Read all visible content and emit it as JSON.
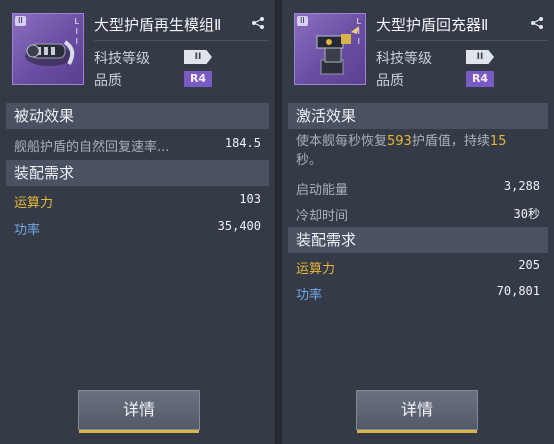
{
  "left": {
    "title": "大型护盾再生模组Ⅱ",
    "tier_badge": "II",
    "tech_label": "科技等级",
    "tech_badge": "II",
    "quality_label": "品质",
    "quality_badge": "R4",
    "passive_header": "被动效果",
    "passive_text": "舰船护盾的自然回复速率...",
    "passive_value": "184.5",
    "req_header": "装配需求",
    "cpu_label": "运算力",
    "cpu_value": "103",
    "power_label": "功率",
    "power_value": "35,400",
    "details_button": "详情"
  },
  "right": {
    "title": "大型护盾回充器Ⅱ",
    "tier_badge": "II",
    "tech_label": "科技等级",
    "tech_badge": "II",
    "quality_label": "品质",
    "quality_badge": "R4",
    "active_header": "激活效果",
    "active_text_1": "使本舰每秒恢复",
    "active_num_1": "593",
    "active_text_2": "护盾值，持续",
    "active_num_2": "15",
    "active_text_3": "秒。",
    "activation_label": "启动能量",
    "activation_value": "3,288",
    "cooldown_label": "冷却时间",
    "cooldown_value": "30秒",
    "req_header": "装配需求",
    "cpu_label": "运算力",
    "cpu_value": "205",
    "power_label": "功率",
    "power_value": "70,801",
    "details_button": "详情"
  },
  "colors": {
    "accent_yellow": "#e6b638",
    "accent_blue": "#6fa8e3",
    "quality_purple": "#7a5bc4"
  },
  "icons": [
    "share-icon",
    "module-icon"
  ]
}
